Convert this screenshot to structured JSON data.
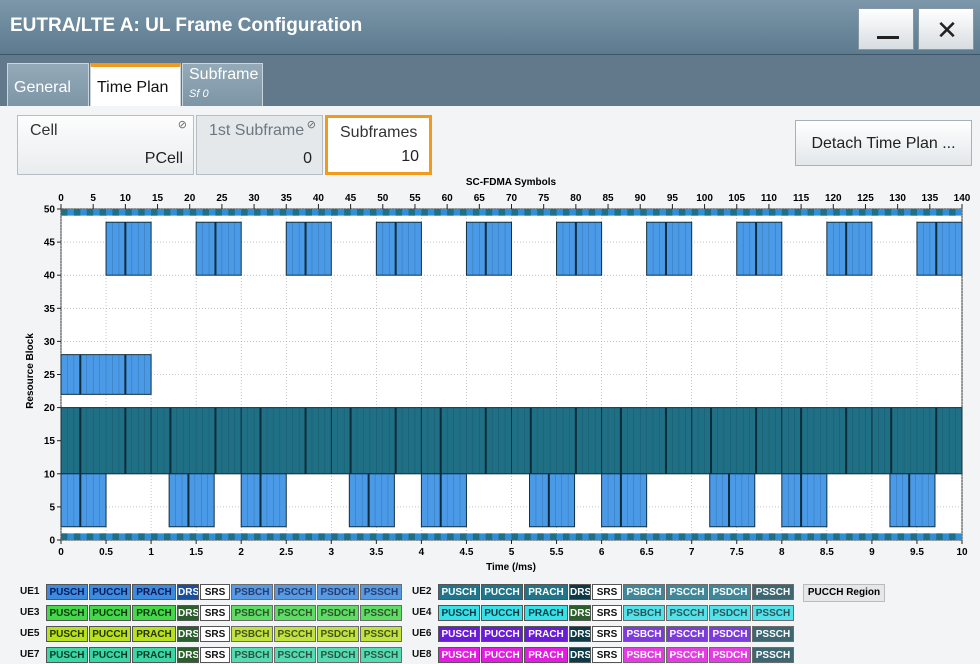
{
  "window": {
    "title": "EUTRA/LTE A: UL Frame Configuration"
  },
  "tabs": [
    {
      "label": "General"
    },
    {
      "label": "Time Plan"
    },
    {
      "label": "Subframe",
      "sub": "Sf 0"
    }
  ],
  "fields": {
    "cell": {
      "caption": "Cell",
      "value": "PCell"
    },
    "first_subframe": {
      "caption": "1st Subframe",
      "value": "0"
    },
    "subframes": {
      "caption": "Subframes",
      "value": "10"
    }
  },
  "detach_button": "Detach Time Plan ...",
  "chart_data": {
    "type": "heatmap",
    "title": "",
    "top_axis_label": "SC-FDMA Symbols",
    "top_ticks": [
      "0",
      "5",
      "10",
      "15",
      "20",
      "25",
      "30",
      "35",
      "40",
      "45",
      "50",
      "55",
      "60",
      "65",
      "70",
      "75",
      "80",
      "85",
      "90",
      "95",
      "100",
      "105",
      "110",
      "115",
      "120",
      "125",
      "130",
      "135",
      "140"
    ],
    "xlabel": "Time (/ms)",
    "x_ticks": [
      "0",
      "0.5",
      "1",
      "1.5",
      "2",
      "2.5",
      "3",
      "3.5",
      "4",
      "4.5",
      "5",
      "5.5",
      "6",
      "6.5",
      "7",
      "7.5",
      "8",
      "8.5",
      "9",
      "9.5",
      "10"
    ],
    "xlim": [
      0,
      10
    ],
    "ylabel": "Resource Block",
    "y_ticks": [
      "0",
      "5",
      "10",
      "15",
      "20",
      "25",
      "30",
      "35",
      "40",
      "45",
      "50"
    ],
    "ylim": [
      0,
      50
    ],
    "grid": true,
    "allocations": [
      {
        "ue": "UE1",
        "channel": "PUSCH",
        "rb_start": 40,
        "rb_end": 48,
        "subframes": [
          0.5,
          1.5,
          2.5,
          3.5,
          4.5,
          5.5,
          6.5,
          7.5,
          8.5,
          9.5
        ],
        "duration_ms": 0.5
      },
      {
        "ue": "UE1",
        "channel": "PUSCH",
        "rb_start": 22,
        "rb_end": 28,
        "subframes": [
          0
        ],
        "duration_ms": 1
      },
      {
        "ue": "UE2",
        "channel": "PUSCH",
        "rb_start": 10,
        "rb_end": 20,
        "subframes": [
          0,
          1,
          3,
          5,
          7,
          9
        ],
        "duration_ms": 1
      },
      {
        "ue": "UE2",
        "channel": "PUSCH",
        "rb_start": 10,
        "rb_end": 20,
        "subframes": [
          2,
          4,
          6,
          8
        ],
        "duration_ms": 1
      },
      {
        "ue": "UE1",
        "channel": "PUSCH",
        "rb_start": 2,
        "rb_end": 10,
        "subframes": [
          0,
          1.2,
          2,
          3.2,
          4,
          5.2,
          6,
          7.2,
          8,
          9.2
        ],
        "duration_ms": 0.5
      }
    ],
    "colors": {
      "ue1": "#4a9ae8",
      "ue2": "#1f6f85",
      "border": "#10313f"
    }
  },
  "legend": {
    "rows": [
      {
        "ue": "UE1",
        "color": "#3b8be0",
        "text": "#0a1a55",
        "dark": false
      },
      {
        "ue": "UE2",
        "color": "#21758a",
        "text": "#ffffff",
        "dark": true
      },
      {
        "ue": "UE3",
        "color": "#45d84a",
        "text": "#0a3a0a",
        "dark": false
      },
      {
        "ue": "UE4",
        "color": "#38e0e8",
        "text": "#063a40",
        "dark": false
      },
      {
        "ue": "UE5",
        "color": "#b8e21d",
        "text": "#2a3400",
        "dark": false
      },
      {
        "ue": "UE6",
        "color": "#6a1bd8",
        "text": "#ffffff",
        "dark": true
      },
      {
        "ue": "UE7",
        "color": "#3bd6a4",
        "text": "#063a2a",
        "dark": false
      },
      {
        "ue": "UE8",
        "color": "#e21ce0",
        "text": "#ffffff",
        "dark": true
      }
    ],
    "channels": [
      "PUSCH",
      "PUCCH",
      "PRACH",
      "DRS",
      "SRS",
      "PSBCH",
      "PSCCH",
      "PSDCH",
      "PSSCH"
    ],
    "pucch_region": "PUCCH Region"
  }
}
